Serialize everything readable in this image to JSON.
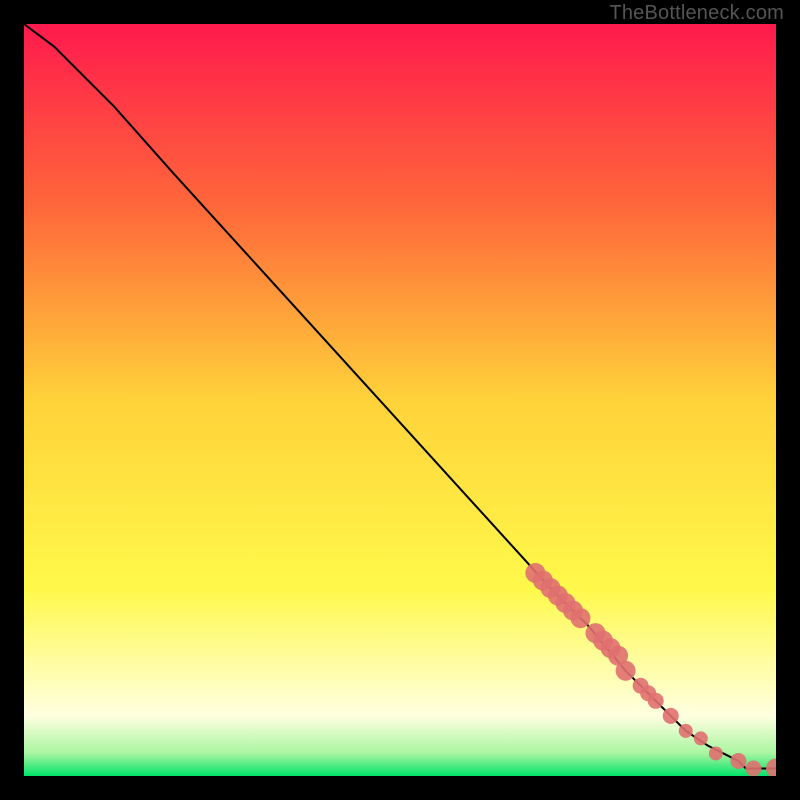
{
  "attribution": "TheBottleneck.com",
  "chart_data": {
    "type": "line",
    "title": "",
    "xlabel": "",
    "ylabel": "",
    "xlim": [
      0,
      100
    ],
    "ylim": [
      0,
      100
    ],
    "grid": false,
    "legend": false,
    "background_gradient": {
      "stops": [
        {
          "pos": 0.0,
          "color": "#ff1a4d"
        },
        {
          "pos": 0.25,
          "color": "#ff6a3a"
        },
        {
          "pos": 0.5,
          "color": "#ffd23a"
        },
        {
          "pos": 0.75,
          "color": "#fff94a"
        },
        {
          "pos": 0.92,
          "color": "#ffffe0"
        },
        {
          "pos": 0.97,
          "color": "#a8f5a0"
        },
        {
          "pos": 1.0,
          "color": "#00e36a"
        }
      ]
    },
    "series": [
      {
        "name": "curve",
        "type": "line",
        "color": "#000000",
        "x": [
          0,
          4,
          8,
          12,
          20,
          30,
          40,
          50,
          60,
          70,
          75,
          80,
          84,
          88,
          91,
          93,
          95,
          96,
          97,
          100
        ],
        "y": [
          100,
          97,
          93,
          89,
          80,
          69,
          58,
          47,
          36,
          25,
          20,
          14,
          10,
          6,
          4,
          3,
          2,
          1,
          1,
          1
        ]
      },
      {
        "name": "points",
        "type": "scatter",
        "color": "#e07070",
        "x": [
          68,
          69,
          70,
          71,
          72,
          73,
          74,
          76,
          77,
          78,
          79,
          80,
          82,
          83,
          84,
          86,
          88,
          90,
          92,
          95,
          97,
          100
        ],
        "y": [
          27,
          26,
          25,
          24,
          23,
          22,
          21,
          19,
          18,
          17,
          16,
          14,
          12,
          11,
          10,
          8,
          6,
          5,
          3,
          2,
          1,
          1
        ],
        "radius": [
          10,
          10,
          10,
          10,
          10,
          10,
          10,
          10,
          10,
          10,
          10,
          10,
          8,
          8,
          8,
          8,
          7,
          7,
          7,
          8,
          8,
          10
        ]
      }
    ]
  }
}
